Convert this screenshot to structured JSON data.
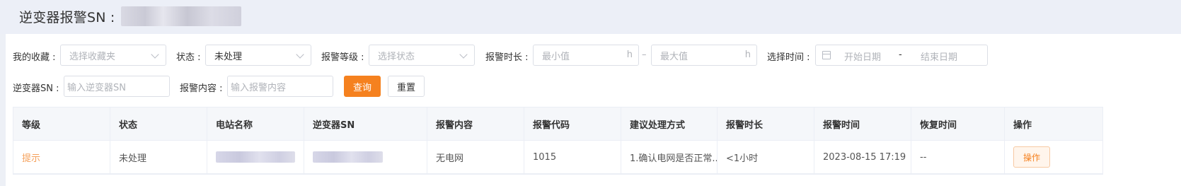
{
  "header": {
    "title": "逆变器报警SN :"
  },
  "filters": {
    "favorites": {
      "label": "我的收藏 :",
      "placeholder": "选择收藏夹"
    },
    "status": {
      "label": "状态 :",
      "value": "未处理"
    },
    "level": {
      "label": "报警等级 :",
      "placeholder": "选择状态"
    },
    "duration": {
      "label": "报警时长 :",
      "min_placeholder": "最小值",
      "max_placeholder": "最大值",
      "unit": "h",
      "separator": "–"
    },
    "time": {
      "label": "选择时间 :",
      "start_placeholder": "开始日期",
      "end_placeholder": "结束日期",
      "separator": "-"
    },
    "inverter_sn": {
      "label": "逆变器SN :",
      "placeholder": "输入逆变器SN"
    },
    "content": {
      "label": "报警内容 :",
      "placeholder": "输入报警内容"
    },
    "query_button": "查询",
    "reset_button": "重置"
  },
  "table": {
    "columns": [
      "等级",
      "状态",
      "电站名称",
      "逆变器SN",
      "报警内容",
      "报警代码",
      "建议处理方式",
      "报警时长",
      "报警时间",
      "恢复时间",
      "操作"
    ],
    "rows": [
      {
        "level": "提示",
        "status": "未处理",
        "alarm_content": "无电网",
        "alarm_code": "1015",
        "suggestion": "1.确认电网是否正常...",
        "duration": "<1小时",
        "alarm_time": "2023-08-15 17:19",
        "recovery_time": "--",
        "action": "操作"
      }
    ]
  },
  "colors": {
    "accent": "#f5811f",
    "level_hint": "#f5a05a"
  }
}
